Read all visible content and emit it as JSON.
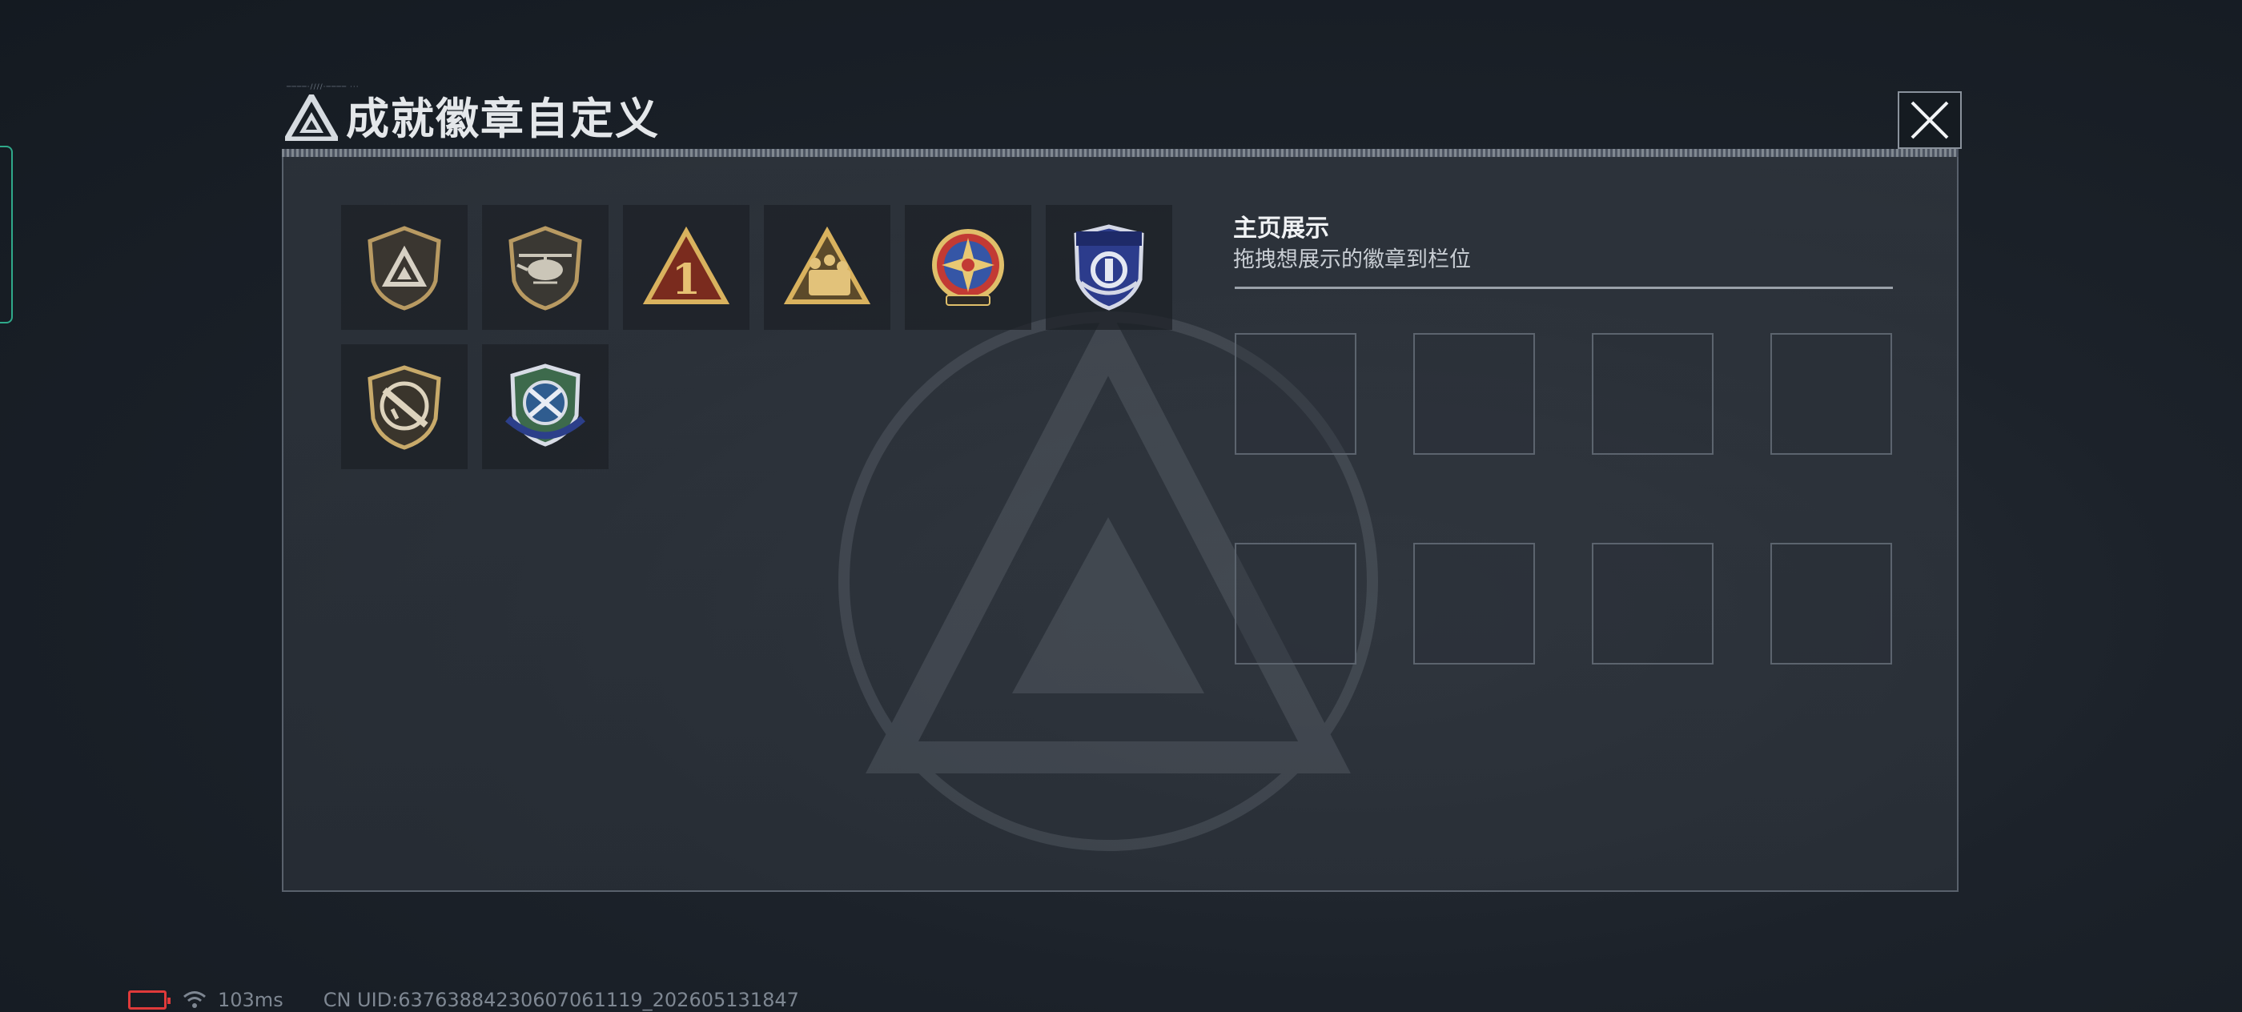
{
  "header": {
    "title": "成就徽章自定义",
    "fine_text": "────·////·──── ···",
    "close_label": "×"
  },
  "badges": [
    {
      "name": "shield-triangle-badge"
    },
    {
      "name": "helicopter-badge"
    },
    {
      "name": "rank-one-triangle-badge"
    },
    {
      "name": "squad-triangle-badge"
    },
    {
      "name": "star-compass-medal-badge"
    },
    {
      "name": "blue-crest-badge"
    },
    {
      "name": "rifle-shield-badge"
    },
    {
      "name": "blue-wing-crest-badge"
    }
  ],
  "showcase": {
    "title": "主页展示",
    "hint": "拖拽想展示的徽章到栏位",
    "slot_count": 8
  },
  "status": {
    "ping": "103ms",
    "uid": "CN UID:63763884230607061119_202605131847"
  },
  "colors": {
    "accent_green": "#2fa98a",
    "battery_red": "#e03a3a",
    "gold": "#c9a45a"
  }
}
